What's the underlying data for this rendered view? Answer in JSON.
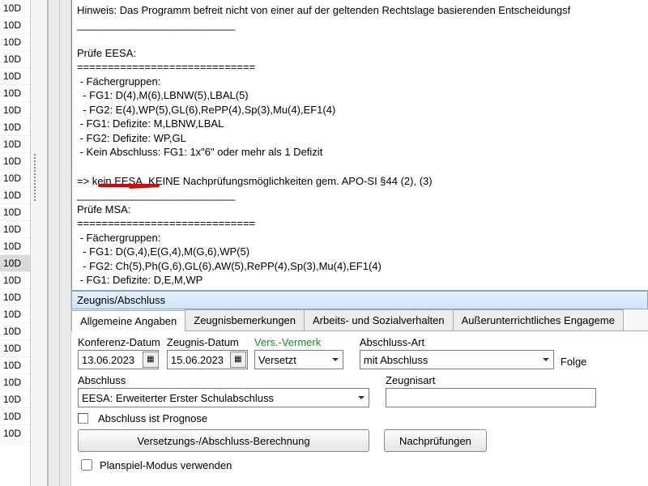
{
  "sidebar": {
    "items": [
      "10D",
      "10D",
      "10D",
      "10D",
      "10D",
      "10D",
      "10D",
      "10D",
      "10D",
      "10D",
      "10D",
      "10D",
      "10D",
      "10D",
      "10D",
      "10D",
      "10D",
      "10D",
      "10D",
      "10D",
      "10D",
      "10D",
      "10D",
      "10D",
      "10D",
      "10D"
    ],
    "selectedIndex": 15
  },
  "log": {
    "line_hint": "Hinweis: Das Programm befreit nicht von einer auf der geltenden Rechtslage basierenden Entscheidungsf",
    "sep_long": "___________________________",
    "eesa_header": "Prüfe EESA:",
    "bar": "=============================",
    "eesa_lines": [
      " - Fächergruppen:",
      "  - FG1: D(4),M(6),LBNW(5),LBAL(5)",
      "  - FG2: E(4),WP(5),GL(6),RePP(4),Sp(3),Mu(4),EF1(4)",
      " - FG1: Defizite: M,LBNW,LBAL",
      " - FG2: Defizite: WP,GL",
      " - Kein Abschluss: FG1: 1x\"6\" oder mehr als 1 Defizit"
    ],
    "eesa_result": "=> kein EESA, KEINE Nachprüfungsmöglichkeiten gem. APO-SI §44 (2), (3)",
    "msa_header": "Prüfe MSA:",
    "msa_lines": [
      " - Fächergruppen:",
      "  - FG1: D(G,4),E(G,4),M(G,6),WP(5)",
      "  - FG2: Ch(5),Ph(G,6),GL(6),AW(5),RePP(4),Sp(3),Mu(4),EF1(4)",
      " - FG1: Defizite: D,E,M,WP"
    ]
  },
  "panel": {
    "title": "Zeugnis/Abschluss",
    "tabs": [
      "Allgemeine Angaben",
      "Zeugnisbemerkungen",
      "Arbeits- und Sozialverhalten",
      "Außerunterrichtliches Engageme"
    ],
    "activeTab": 0,
    "labels": {
      "konferenz": "Konferenz-Datum",
      "zeugnis": "Zeugnis-Datum",
      "vermerk": "Vers.-Vermerk",
      "abschlussart": "Abschluss-Art",
      "folge": "Folge",
      "abschluss": "Abschluss",
      "zeugnisart": "Zeugnisart",
      "prognose": "Abschluss ist Prognose",
      "planspiel": "Planspiel-Modus verwenden"
    },
    "values": {
      "konferenz": "13.06.2023",
      "zeugnis": "15.06.2023",
      "vermerk": "Versetzt",
      "abschlussart": "mit Abschluss",
      "abschluss": "EESA: Erweiterter Erster Schulabschluss",
      "zeugnisart": ""
    },
    "buttons": {
      "berechnung": "Versetzungs-/Abschluss-Berechnung",
      "nachpruef": "Nachprüfungen"
    }
  }
}
